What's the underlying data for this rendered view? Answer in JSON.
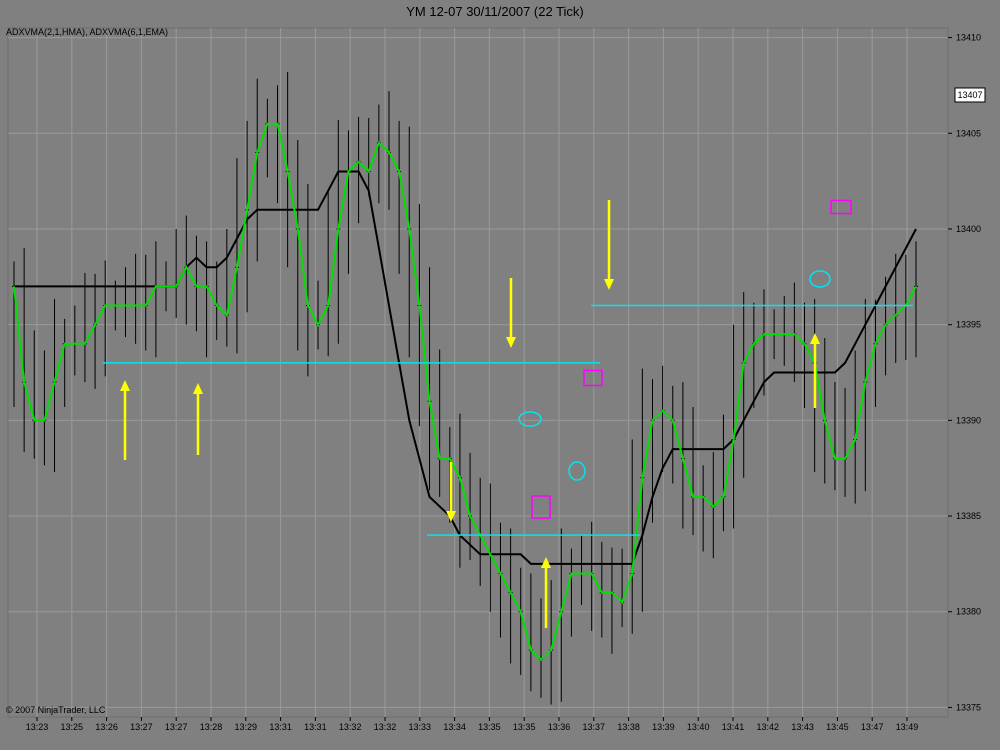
{
  "chart_data": {
    "type": "line",
    "title": "YM 12-07  30/11/2007  (22 Tick)",
    "indicator_label": "ADXVMA(2,1,HMA), ADXVMA(6,1,EMA)",
    "copyright": "© 2007 NinjaTrader, LLC",
    "last_price_label": "13407",
    "x_tick_labels": [
      "13:23",
      "13:25",
      "13:26",
      "13:27",
      "13:27",
      "13:28",
      "13:29",
      "13:31",
      "13:31",
      "13:32",
      "13:32",
      "13:33",
      "13:34",
      "13:35",
      "13:35",
      "13:36",
      "13:37",
      "13:38",
      "13:39",
      "13:40",
      "13:41",
      "13:42",
      "13:43",
      "13:45",
      "13:47",
      "13:49"
    ],
    "ylim": [
      13374.5,
      13410.5
    ],
    "y_ticks": [
      13375,
      13380,
      13385,
      13390,
      13395,
      13400,
      13405,
      13410
    ],
    "grid": true,
    "bar_count": 90,
    "colors": {
      "background": "#808080",
      "grid": "#9a9a9a",
      "bars": "#000000",
      "fast_line": "#00e000",
      "slow_line": "#000000",
      "support_line": "#00e5ee",
      "arrow": "#ffff00",
      "marker_square": "#ff00ff",
      "marker_ellipse": "#00e5ee"
    },
    "series": [
      {
        "values": [
          13397,
          13392,
          13390,
          13390,
          13392,
          13394,
          13394,
          13394,
          13395,
          13396,
          13396,
          13396,
          13396,
          13396,
          13397,
          13397,
          13397,
          13398,
          13397,
          13397,
          13396,
          13395.5,
          13398,
          13401,
          13404,
          13405.5,
          13405.5,
          13403,
          13400,
          13396,
          13395,
          13396,
          13400,
          13403,
          13403.5,
          13403,
          13404.5,
          13404,
          13403,
          13400,
          13396,
          13391,
          13388,
          13388,
          13387,
          13385,
          13384,
          13383,
          13382,
          13381,
          13380,
          13378,
          13377.5,
          13378,
          13380,
          13382,
          13382,
          13382,
          13381,
          13381,
          13380.5,
          13382,
          13387,
          13390,
          13390.5,
          13390,
          13388,
          13386,
          13386,
          13385.5,
          13386,
          13389,
          13393,
          13394,
          13394.5,
          13394.5,
          13394.5,
          13394.5,
          13394,
          13393,
          13390,
          13388,
          13388,
          13389,
          13392,
          13394,
          13395,
          13395.5,
          13396,
          13397
        ],
        "style": "fast"
      },
      {
        "values": [
          13397,
          13397,
          13397,
          13397,
          13397,
          13397,
          13397,
          13397,
          13397,
          13397,
          13397,
          13397,
          13397,
          13397,
          13397,
          13397,
          13397,
          13398,
          13398.5,
          13398,
          13398,
          13398.5,
          13399.5,
          13400.5,
          13401,
          13401,
          13401,
          13401,
          13401,
          13401,
          13401,
          13402,
          13403,
          13403,
          13403,
          13402,
          13399,
          13396,
          13393,
          13390,
          13388,
          13386,
          13385.5,
          13385,
          13384,
          13383.5,
          13383,
          13383,
          13383,
          13383,
          13383,
          13382.5,
          13382.5,
          13382.5,
          13382.5,
          13382.5,
          13382.5,
          13382.5,
          13382.5,
          13382.5,
          13382.5,
          13382.5,
          13384,
          13386,
          13387.5,
          13388.5,
          13388.5,
          13388.5,
          13388.5,
          13388.5,
          13388.5,
          13389,
          13390,
          13391,
          13392,
          13392.5,
          13392.5,
          13392.5,
          13392.5,
          13392.5,
          13392.5,
          13392.5,
          13393,
          13394,
          13395,
          13396,
          13397,
          13398,
          13399,
          13400
        ],
        "style": "slow"
      }
    ]
  }
}
